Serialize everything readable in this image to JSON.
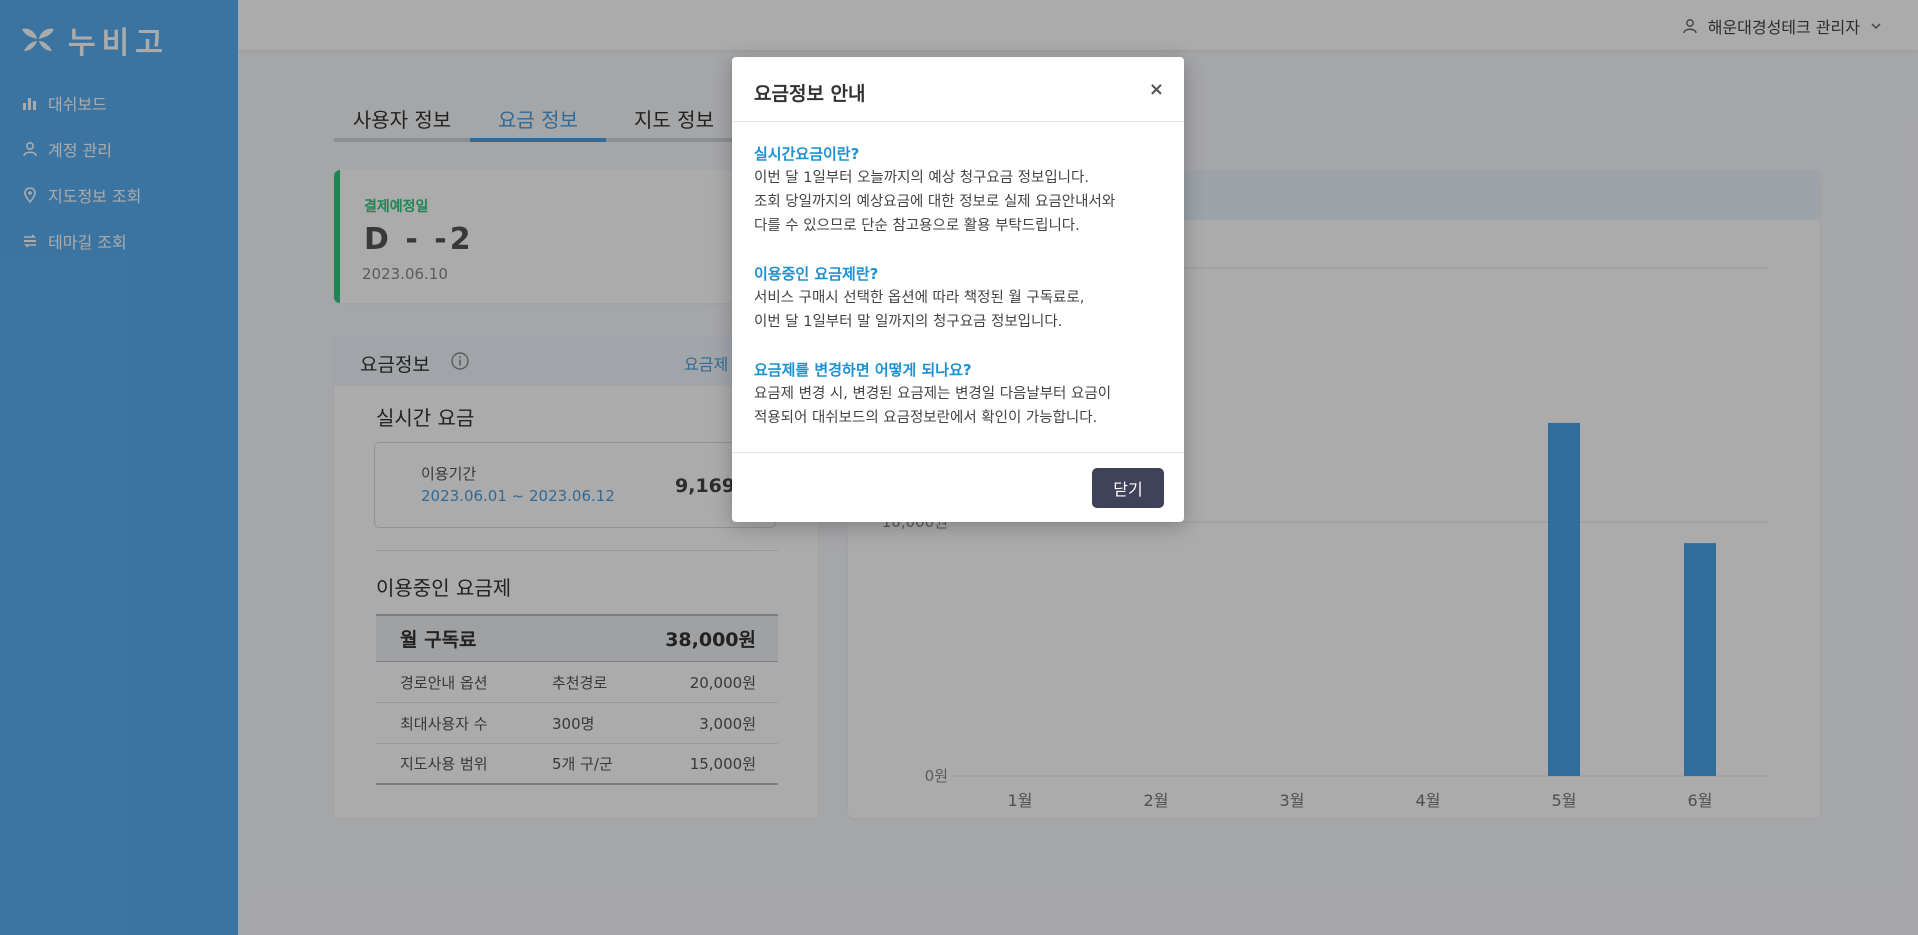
{
  "brand": {
    "name": "누비고"
  },
  "sidebar": {
    "items": [
      {
        "label": "대쉬보드",
        "icon": "bar-chart-icon"
      },
      {
        "label": "계정 관리",
        "icon": "user-icon"
      },
      {
        "label": "지도정보 조회",
        "icon": "map-pin-icon"
      },
      {
        "label": "테마길 조회",
        "icon": "route-icon"
      }
    ]
  },
  "header": {
    "user": "해운대경성테크 관리자"
  },
  "tabs": [
    {
      "label": "사용자 정보",
      "active": false
    },
    {
      "label": "요금 정보",
      "active": true
    },
    {
      "label": "지도 정보",
      "active": false
    }
  ],
  "billing_date": {
    "label": "결제예정일",
    "dday": "D - -2",
    "date": "2023.06.10"
  },
  "fee_info": {
    "title": "요금정보",
    "link": "요금제",
    "realtime_title": "실시간 요금",
    "period_label": "이용기간",
    "period": "2023.06.01 ~ 2023.06.12",
    "amount": "9,169",
    "plan_title": "이용중인 요금제",
    "plan_head_label": "월 구독료",
    "plan_head_value": "38,000원",
    "rows": [
      {
        "name": "경로안내 옵션",
        "option": "추천경로",
        "price": "20,000원"
      },
      {
        "name": "최대사용자 수",
        "option": "300명",
        "price": "3,000원"
      },
      {
        "name": "지도사용 범위",
        "option": "5개 구/군",
        "price": "15,000원"
      }
    ]
  },
  "chart_data": {
    "type": "bar",
    "categories": [
      "1월",
      "2월",
      "3월",
      "4월",
      "5월",
      "6월"
    ],
    "values": [
      0,
      0,
      0,
      0,
      13900,
      9169
    ],
    "ytick_labels": [
      "0원",
      "10,000원"
    ],
    "ylim": [
      0,
      20000
    ],
    "color": "#4aa3e6"
  },
  "modal": {
    "title": "요금정보 안내",
    "close_symbol": "×",
    "sections": [
      {
        "q": "실시간요금이란?",
        "lines": [
          "이번 달 1일부터 오늘까지의 예상 청구요금 정보입니다.",
          "조회 당일까지의 예상요금에 대한 정보로 실제 요금안내서와",
          "다를 수 있으므로 단순 참고용으로 활용 부탁드립니다."
        ]
      },
      {
        "q": "이용중인 요금제란?",
        "lines": [
          "서비스 구매시 선택한 옵션에 따라 책정된 월 구독료로,",
          "이번 달 1일부터 말 일까지의 청구요금 정보입니다."
        ]
      },
      {
        "q": "요금제를 변경하면 어떻게 되나요?",
        "lines": [
          "요금제 변경 시, 변경된 요금제는 변경일 다음날부터 요금이",
          "적용되어 대쉬보드의 요금정보란에서 확인이 가능합니다."
        ]
      }
    ],
    "button": "닫기"
  }
}
